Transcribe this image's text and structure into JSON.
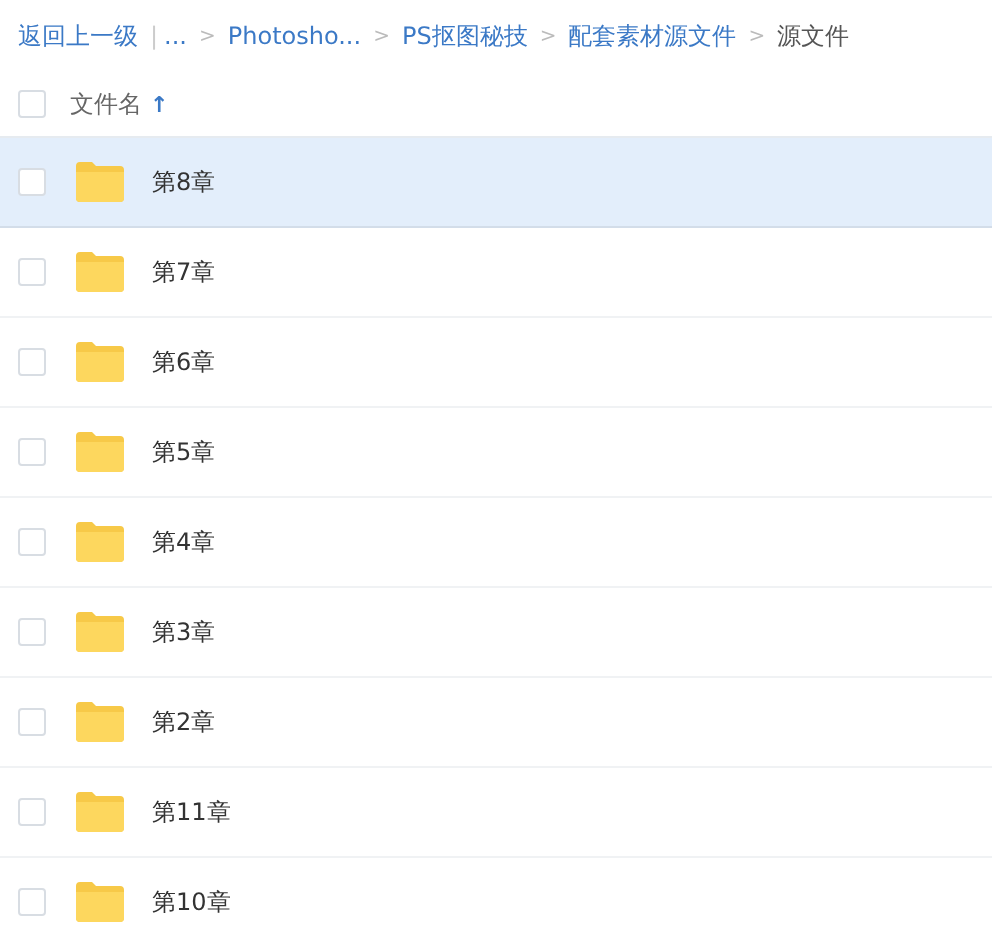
{
  "breadcrumb": [
    {
      "kind": "link",
      "text": "返回上一级"
    },
    {
      "kind": "divider",
      "text": "|"
    },
    {
      "kind": "link",
      "text": "..."
    },
    {
      "kind": "separator",
      "text": ">"
    },
    {
      "kind": "link",
      "text": "Photosho..."
    },
    {
      "kind": "separator",
      "text": ">"
    },
    {
      "kind": "link",
      "text": "PS抠图秘技"
    },
    {
      "kind": "separator",
      "text": ">"
    },
    {
      "kind": "link",
      "text": "配套素材源文件"
    },
    {
      "kind": "separator",
      "text": ">"
    },
    {
      "kind": "current",
      "text": "源文件"
    }
  ],
  "header": {
    "checked": false,
    "column": "文件名",
    "sort_arrow": "↑"
  },
  "rows": [
    {
      "name": "第8章",
      "checked": false,
      "hovered": true
    },
    {
      "name": "第7章",
      "checked": false,
      "hovered": false
    },
    {
      "name": "第6章",
      "checked": false,
      "hovered": false
    },
    {
      "name": "第5章",
      "checked": false,
      "hovered": false
    },
    {
      "name": "第4章",
      "checked": false,
      "hovered": false
    },
    {
      "name": "第3章",
      "checked": false,
      "hovered": false
    },
    {
      "name": "第2章",
      "checked": false,
      "hovered": false
    },
    {
      "name": "第11章",
      "checked": false,
      "hovered": false
    },
    {
      "name": "第10章",
      "checked": false,
      "hovered": false
    }
  ]
}
